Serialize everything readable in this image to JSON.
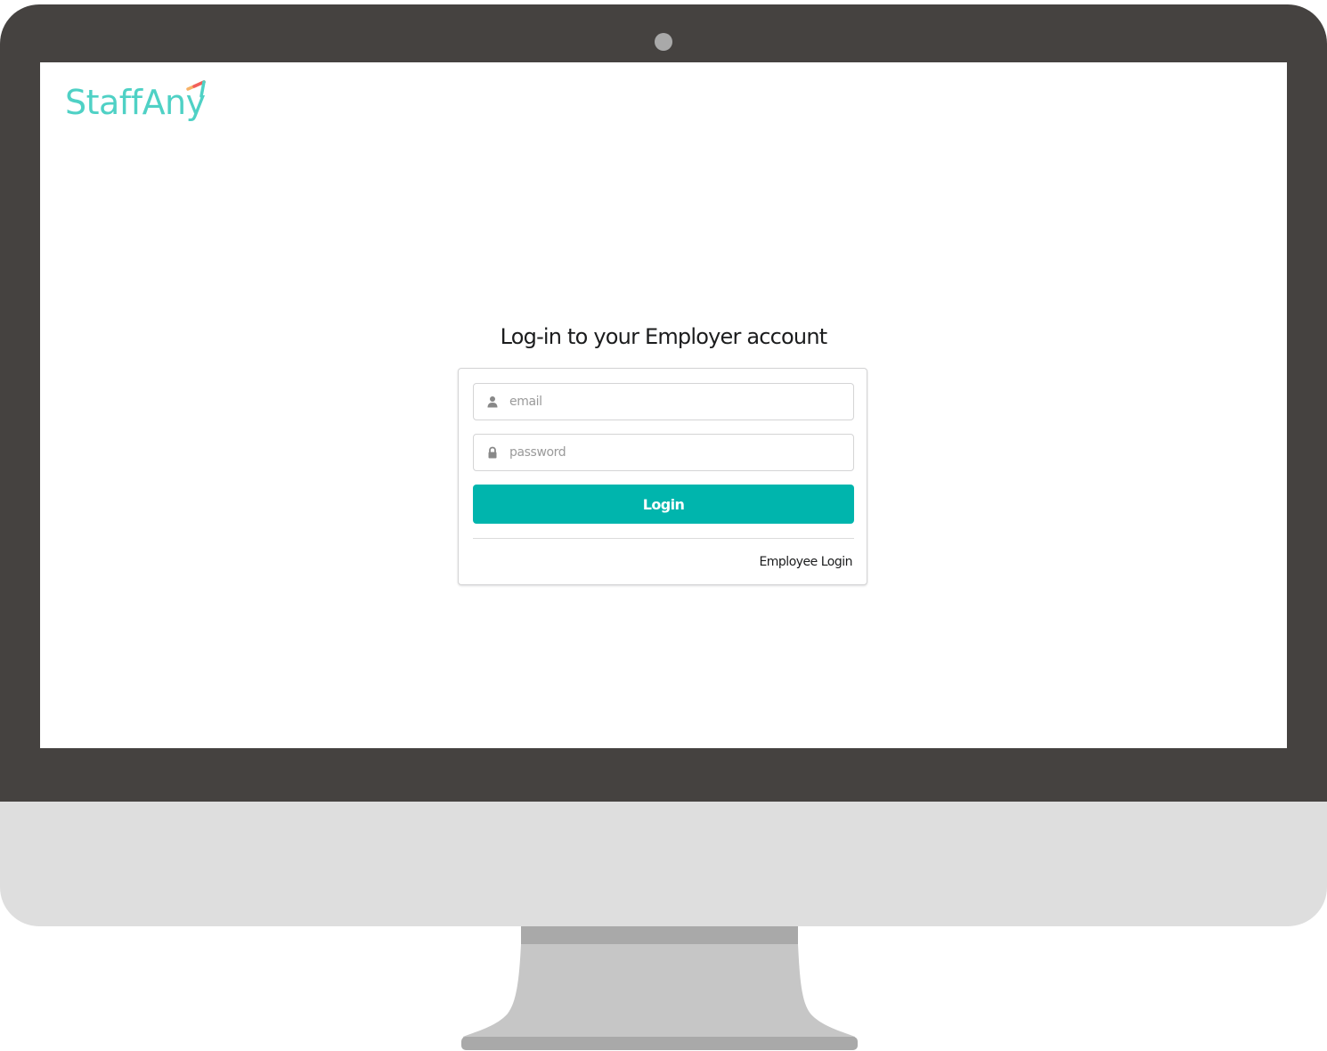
{
  "app": {
    "logo_text": "StaffAny",
    "logo_color": "#4fd1c5"
  },
  "login": {
    "title": "Log-in to your Employer account",
    "email": {
      "placeholder": "email",
      "value": "",
      "icon": "user-icon"
    },
    "password": {
      "placeholder": "password",
      "value": "",
      "icon": "lock-icon"
    },
    "submit_label": "Login",
    "employee_link_label": "Employee Login",
    "accent_color": "#00b5ad"
  },
  "device": {
    "type": "desktop-monitor",
    "bezel_color": "#454240",
    "chin_color": "#dedede"
  }
}
